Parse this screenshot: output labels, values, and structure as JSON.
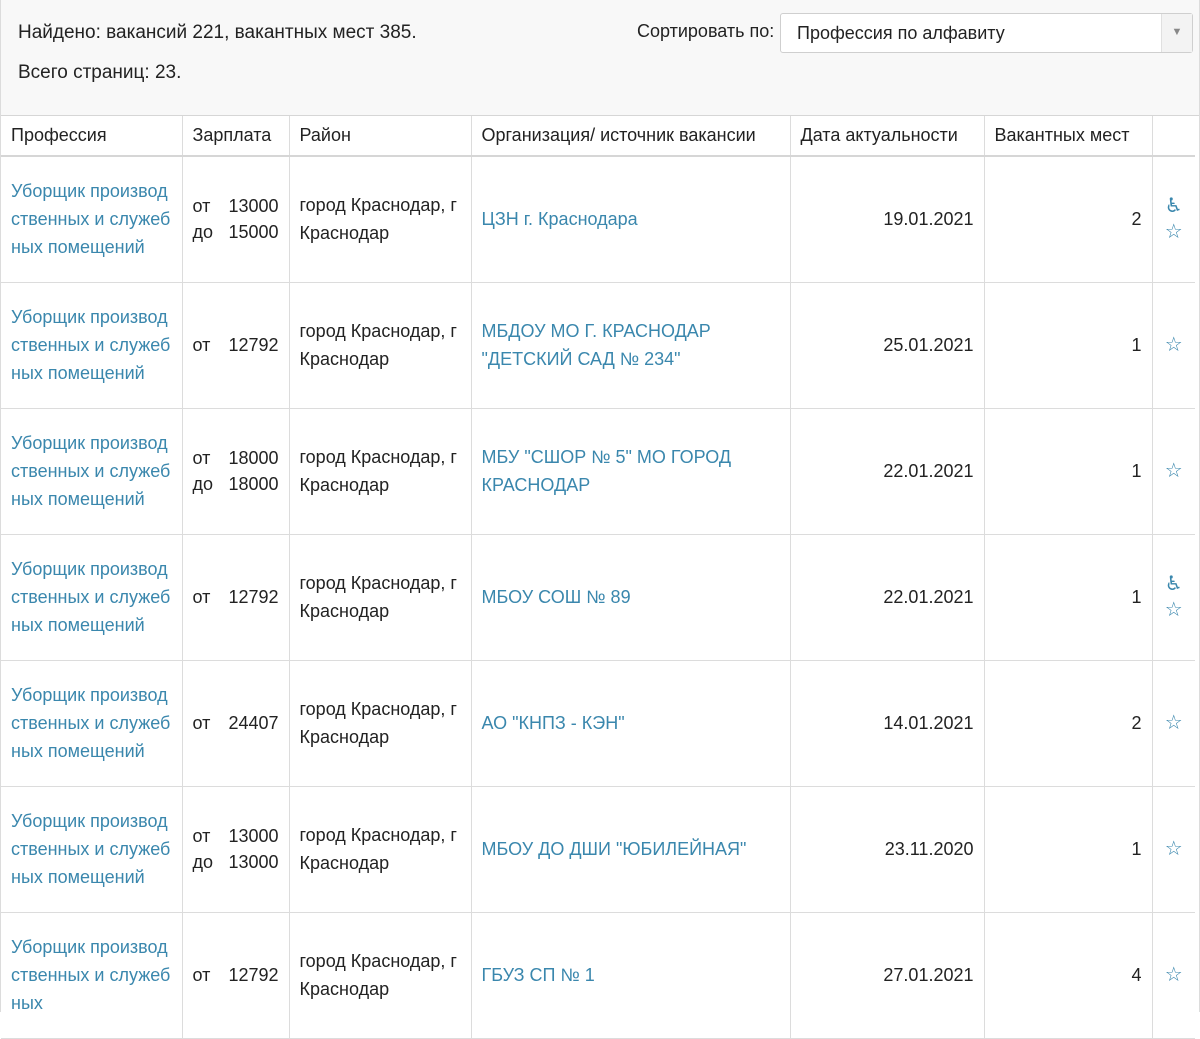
{
  "summary": {
    "found": "Найдено: вакансий 221, вакантных мест 385.",
    "pages": "Всего страниц: 23."
  },
  "sort": {
    "label": "Сортировать по:",
    "value": "Профессия по алфавиту"
  },
  "table": {
    "headers": [
      "Профессия",
      "Зарплата",
      "Район",
      "Организация/ источник вакансии",
      "Дата актуальности",
      "Вакантных мест",
      ""
    ],
    "rows": [
      {
        "profession": "Уборщик производственных и служебных помещений",
        "sal_from": "13000",
        "sal_to": "15000",
        "district": "город Краснодар, г Краснодар",
        "org": "ЦЗН г. Краснодара",
        "date": "19.01.2021",
        "places": "2",
        "accessible": true
      },
      {
        "profession": "Уборщик производственных и служебных помещений",
        "sal_from": "12792",
        "sal_to": "",
        "district": "город Краснодар, г Краснодар",
        "org": "МБДОУ МО Г. КРАСНОДАР \"ДЕТСКИЙ САД № 234\"",
        "date": "25.01.2021",
        "places": "1",
        "accessible": false
      },
      {
        "profession": "Уборщик производственных и служебных помещений",
        "sal_from": "18000",
        "sal_to": "18000",
        "district": "город Краснодар, г Краснодар",
        "org": "МБУ \"СШОР № 5\" МО ГОРОД КРАСНОДАР",
        "date": "22.01.2021",
        "places": "1",
        "accessible": false
      },
      {
        "profession": "Уборщик производственных и служебных помещений",
        "sal_from": "12792",
        "sal_to": "",
        "district": "город Краснодар, г Краснодар",
        "org": "МБОУ СОШ № 89",
        "date": "22.01.2021",
        "places": "1",
        "accessible": true
      },
      {
        "profession": "Уборщик производственных и служебных помещений",
        "sal_from": "24407",
        "sal_to": "",
        "district": "город Краснодар, г Краснодар",
        "org": "АО \"КНПЗ - КЭН\"",
        "date": "14.01.2021",
        "places": "2",
        "accessible": false
      },
      {
        "profession": "Уборщик производственных и служебных помещений",
        "sal_from": "13000",
        "sal_to": "13000",
        "district": "город Краснодар, г Краснодар",
        "org": "МБОУ ДО ДШИ \"ЮБИЛЕЙНАЯ\"",
        "date": "23.11.2020",
        "places": "1",
        "accessible": false
      },
      {
        "profession": "Уборщик производственных и служебных",
        "sal_from": "12792",
        "sal_to": "",
        "district": "город Краснодар, г Краснодар",
        "org": "ГБУЗ СП № 1",
        "date": "27.01.2021",
        "places": "4",
        "accessible": false
      }
    ],
    "sal_from_label": "от",
    "sal_to_label": "до",
    "icons": {
      "accessible": "wheelchair-icon",
      "favorite": "star-icon"
    }
  }
}
